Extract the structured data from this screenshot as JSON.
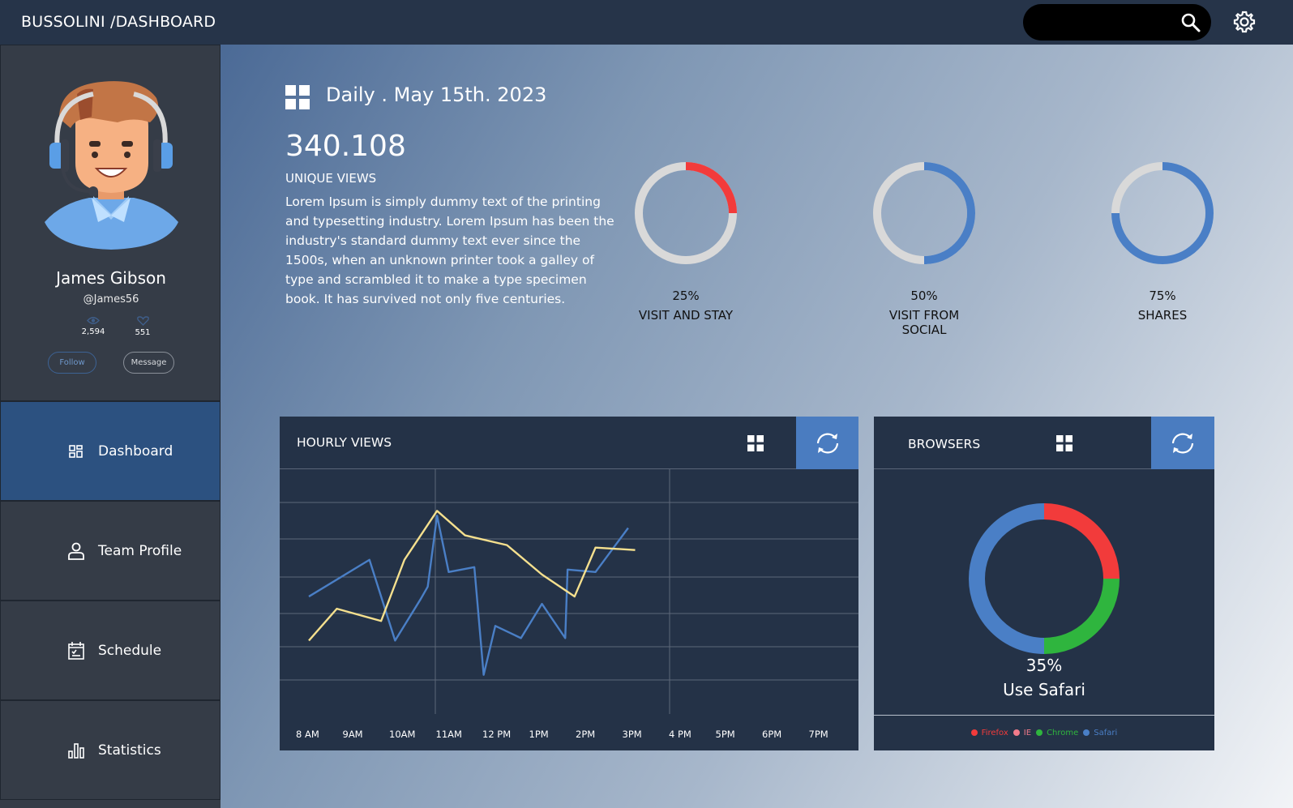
{
  "app": {
    "brand": "BUSSOLINI /DASHBOARD"
  },
  "topbar": {
    "search_placeholder": "",
    "search_icon": "search-icon",
    "settings_icon": "gear-icon"
  },
  "profile": {
    "name": "James Gibson",
    "handle": "@James56",
    "views": "2,594",
    "likes": "551",
    "follow_label": "Follow",
    "message_label": "Message"
  },
  "nav": {
    "items": [
      {
        "label": "Dashboard",
        "icon": "dashboard-icon",
        "active": true
      },
      {
        "label": "Team Profile",
        "icon": "user-icon",
        "active": false
      },
      {
        "label": "Schedule",
        "icon": "calendar-icon",
        "active": false
      },
      {
        "label": "Statistics",
        "icon": "bar-chart-icon",
        "active": false
      }
    ]
  },
  "overview": {
    "title": "Daily . May 15th. 2023",
    "big_number": "340.108",
    "big_label": "UNIQUE VIEWS",
    "description": "Lorem Ipsum is simply dummy text of the printing and typesetting industry. Lorem Ipsum has been the industry's standard dummy text ever since the 1500s, when an unknown printer took a galley of type and scrambled it to make a type specimen book. It has survived not only five centuries."
  },
  "kpis": [
    {
      "percent": "25%",
      "label": "VISIT AND STAY",
      "value": 25,
      "color": "#f23b3b"
    },
    {
      "percent": "50%",
      "label": "VISIT FROM SOCIAL",
      "value": 50,
      "color": "#4a7fc6"
    },
    {
      "percent": "75%",
      "label": "SHARES",
      "value": 75,
      "color": "#4a7fc6"
    }
  ],
  "hourly": {
    "title": "HOURLY VIEWS",
    "grid_icon": "grid-icon",
    "refresh_icon": "refresh-icon"
  },
  "browsers": {
    "title": "BROWSERS",
    "percent": "35%",
    "label": "Use Safari",
    "grid_icon": "grid-icon",
    "refresh_icon": "refresh-icon"
  },
  "chart_data": [
    {
      "type": "line",
      "title": "HOURLY VIEWS",
      "x": [
        "8 AM",
        "9AM",
        "10AM",
        "11AM",
        "12 PM",
        "1PM",
        "2PM",
        "3PM",
        "4 PM",
        "5PM",
        "6PM",
        "7PM"
      ],
      "series": [
        {
          "color": "#4a7fc6",
          "points": [
            [
              0,
              48
            ],
            [
              1.3,
              63
            ],
            [
              1.85,
              30
            ],
            [
              2.4,
              47
            ],
            [
              2.55,
              52
            ],
            [
              2.75,
              81
            ],
            [
              3.0,
              58
            ],
            [
              3.55,
              60
            ],
            [
              3.75,
              16
            ],
            [
              4.0,
              36
            ],
            [
              4.55,
              31
            ],
            [
              5.0,
              45
            ],
            [
              5.5,
              31
            ],
            [
              5.55,
              59
            ],
            [
              6.15,
              58
            ],
            [
              6.85,
              76
            ]
          ]
        },
        {
          "color": "#f5e08e",
          "points": [
            [
              0,
              30
            ],
            [
              0.6,
              43
            ],
            [
              1.55,
              38
            ],
            [
              2.05,
              63
            ],
            [
              2.75,
              83
            ],
            [
              3.35,
              73
            ],
            [
              4.25,
              69
            ],
            [
              5.0,
              57
            ],
            [
              5.7,
              48
            ],
            [
              6.15,
              68
            ],
            [
              7.0,
              67
            ]
          ]
        }
      ],
      "ylim": [
        0,
        100
      ],
      "xlabel": "",
      "ylabel": "",
      "grid": true
    },
    {
      "type": "pie",
      "title": "BROWSERS",
      "categories": [
        "Firefox",
        "IE",
        "Chrome",
        "Safari"
      ],
      "values": [
        25,
        0,
        25,
        50
      ],
      "colors": [
        "#f23b3b",
        "#f27b8a",
        "#2fb53e",
        "#4a7fc6"
      ]
    }
  ]
}
